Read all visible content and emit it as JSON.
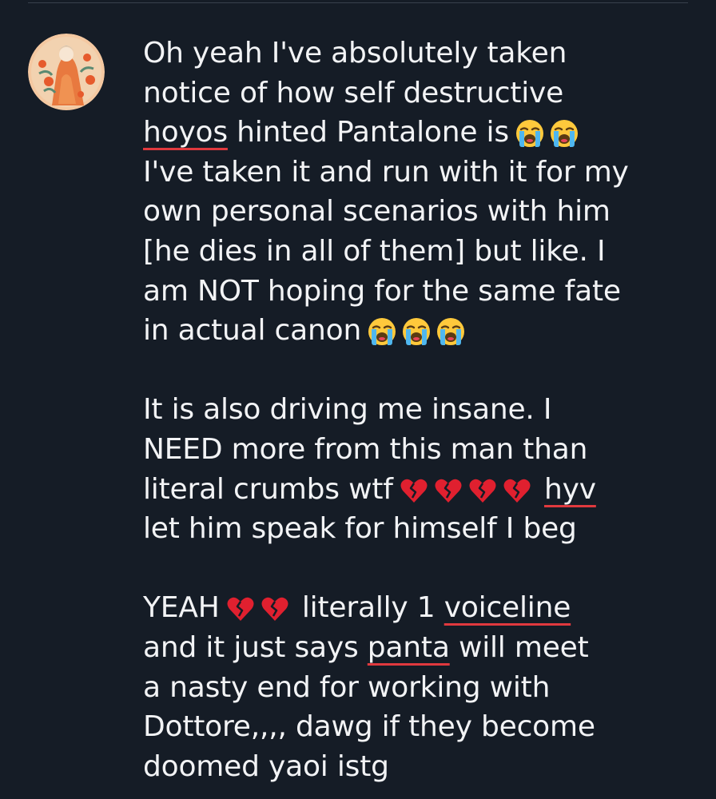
{
  "comment": {
    "lines_p1": [
      "Oh yeah I've absolutely taken",
      "notice of how self destructive",
      "I've taken it and run with it for my",
      "own personal scenarios with him",
      "[he dies in all of them] but like. I",
      "am NOT hoping for the same fate",
      "in actual canon"
    ],
    "line3_word": "hoyos",
    "line3_rest": " hinted Pantalone is",
    "lines_p2": [
      "It is also driving me insane. I",
      "NEED more from this man than",
      "literal crumbs wtf",
      "let him speak for himself I beg"
    ],
    "p2_word": "hyv",
    "p3_line1_start": "YEAH",
    "p3_line1_mid": " literally 1 ",
    "p3_line1_word": "voiceline",
    "p3_line2_start": "and it just says ",
    "p3_line2_word": "panta",
    "p3_line2_end": " will meet",
    "lines_p3": [
      "a nasty end for working with",
      "Dottore,,,, dawg if they become",
      "doomed yaoi istg"
    ]
  },
  "emoji": {
    "crying": "loudly-crying-face-emoji",
    "broken": "broken-heart-emoji"
  },
  "colors": {
    "background": "#151c26",
    "text": "#f2f3f5",
    "spellcheck": "#e0393e"
  }
}
